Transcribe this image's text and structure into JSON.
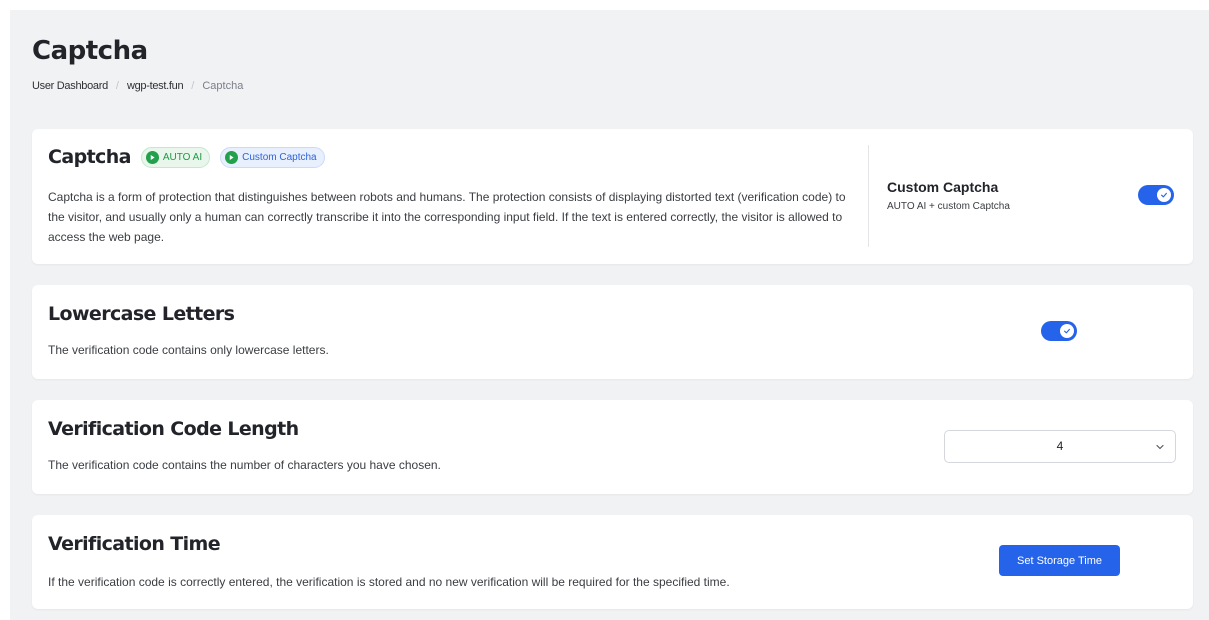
{
  "header": {
    "title": "Captcha",
    "breadcrumb": [
      {
        "label": "User Dashboard"
      },
      {
        "label": "wgp-test.fun"
      },
      {
        "label": "Captcha"
      }
    ]
  },
  "captcha_card": {
    "title": "Captcha",
    "badges": [
      {
        "label": "AUTO AI",
        "icon": "play-circle-icon",
        "color": "#22a04b"
      },
      {
        "label": "Custom Captcha",
        "icon": "play-circle-icon",
        "color": "#2f63d8"
      }
    ],
    "description": "Captcha is a form of protection that distinguishes between robots and humans. The protection consists of displaying distorted text (verification code) to the visitor, and usually only a human can correctly transcribe it into the corresponding input field. If the text is entered correctly, the visitor is allowed to access the web page.",
    "side_title": "Custom Captcha",
    "side_subtitle": "AUTO AI + custom Captcha",
    "toggle_on": true
  },
  "lowercase_card": {
    "title": "Lowercase Letters",
    "description": "The verification code contains only lowercase letters.",
    "toggle_on": true
  },
  "length_card": {
    "title": "Verification Code Length",
    "description": "The verification code contains the number of characters you have chosen.",
    "selected_value": "4"
  },
  "time_card": {
    "title": "Verification Time",
    "description": "If the verification code is correctly entered, the verification is stored and no new verification will be required for the specified time.",
    "button_label": "Set Storage Time"
  },
  "colors": {
    "accent": "#2563eb",
    "success": "#22a04b",
    "background": "#f1f2f4"
  }
}
